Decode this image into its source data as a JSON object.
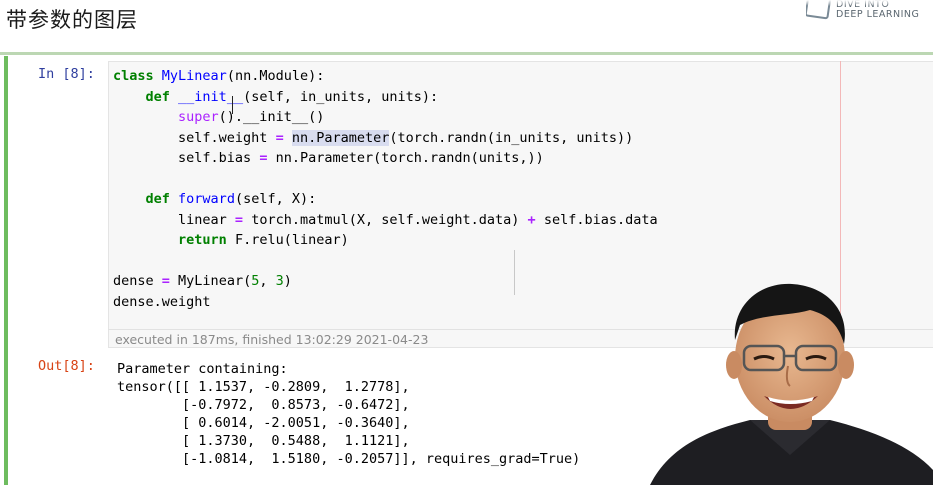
{
  "slide": {
    "title": "带参数的图层"
  },
  "logo": {
    "line1": "DIVE INTO",
    "line2": "DEEP LEARNING"
  },
  "cell": {
    "input_prompt": "In [8]:",
    "output_prompt": "Out[8]:",
    "execution_info": "executed in 187ms, finished 13:02:29 2021-04-23"
  },
  "code": {
    "l1": [
      "class",
      " ",
      "MyLinear",
      "(nn.Module):"
    ],
    "l2": [
      "    ",
      "def",
      " ",
      "__init__",
      "(self, in_units, units):"
    ],
    "l3": [
      "        ",
      "super",
      "().__init__()"
    ],
    "l4": [
      "        self.weight ",
      "=",
      " ",
      "nn.Parameter",
      "(torch.randn(in_units, units))"
    ],
    "l5": [
      "        self.bias ",
      "=",
      " nn.Parameter(torch.randn(units,))"
    ],
    "l6": [
      "    ",
      "def",
      " ",
      "forward",
      "(self, X):"
    ],
    "l7": [
      "        linear ",
      "=",
      " torch.matmul(X, self.weight.data) ",
      "+",
      " self.bias.data"
    ],
    "l8": [
      "        ",
      "return",
      " F.relu(linear)"
    ],
    "l9": [
      "dense ",
      "=",
      " MyLinear(",
      "5",
      ", ",
      "3",
      ")"
    ],
    "l10": [
      "dense.weight"
    ]
  },
  "output": {
    "lines": [
      "Parameter containing:",
      "tensor([[ 1.1537, -0.2809,  1.2778],",
      "        [-0.7972,  0.8573, -0.6472],",
      "        [ 0.6014, -2.0051, -0.3640],",
      "        [ 1.3730,  0.5488,  1.1121],",
      "        [-1.0814,  1.5180, -0.2057]], requires_grad=True)"
    ]
  },
  "colors": {
    "keyword": "#008000",
    "function_name": "#0000ff",
    "builtin": "#aa22ff",
    "prompt_in": "#303f9f",
    "prompt_out": "#d84315",
    "cell_bar": "#6ebc5f"
  },
  "icons": {
    "logo": "dive-into-deep-learning-logo",
    "presenter": "presenter-webcam"
  }
}
